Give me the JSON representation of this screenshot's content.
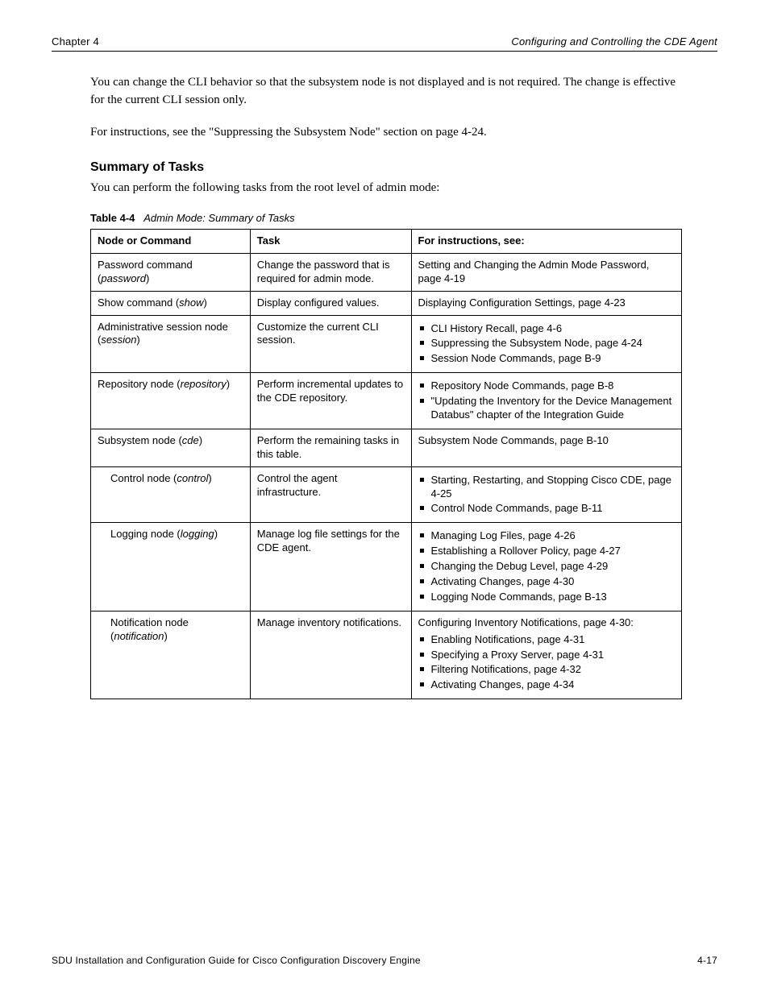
{
  "header": {
    "left": "Chapter 4",
    "right": "Configuring and Controlling the CDE Agent"
  },
  "para1": "You can change the CLI behavior so that the subsystem node is not displayed and is not required. The change is effective for the current CLI session only.",
  "para2_prefix": "For instructions, see the ",
  "para2_link": "\"Suppressing the Subsystem Node\" section on page 4-24",
  "para2_suffix": ".",
  "section_title": "Summary of Tasks",
  "section_subtitle": "You can perform the following tasks from the root level of admin mode:",
  "table_caption_label": "Table 4-4",
  "table_caption_text": "Admin Mode: Summary of Tasks",
  "table": {
    "headers": [
      "Node or Command",
      "Task",
      "For instructions, see:"
    ],
    "rows": [
      {
        "node": "Password command (password)",
        "nodeItalic": "password",
        "nodeItalicMode": "paren",
        "task": "Change the password that is required for admin mode.",
        "see": "Setting and Changing the Admin Mode Password, page 4-19"
      },
      {
        "node": "Show command (show)",
        "nodeItalic": "show",
        "nodeItalicMode": "paren",
        "task": "Display configured values.",
        "see": "Displaying Configuration Settings, page 4-23"
      },
      {
        "node": "Administrative session node (session)",
        "nodeItalic": "session",
        "nodeItalicMode": "paren",
        "task": "Customize the current CLI session.",
        "seeList": [
          "CLI History Recall, page 4-6",
          "Suppressing the Subsystem Node, page 4-24",
          "Session Node Commands, page B-9"
        ]
      },
      {
        "node": "Repository node (repository)",
        "nodeItalic": "repository",
        "nodeItalicMode": "paren",
        "task": "Perform incremental updates to the CDE repository.",
        "seeList": [
          "Repository Node Commands, page B-8",
          "\"Updating the Inventory for the Device Management Databus\" chapter of the Integration Guide"
        ]
      },
      {
        "node": "Subsystem node (cde)",
        "nodeItalic": "cde",
        "nodeItalicMode": "paren",
        "task": "Perform the remaining tasks in this table.",
        "see": "Subsystem Node Commands, page B-10"
      },
      {
        "node": "    Control node (control)",
        "nodeItalic": "control",
        "nodeItalicMode": "paren",
        "task": "Control the agent infrastructure.",
        "seeList": [
          "Starting, Restarting, and Stopping Cisco CDE, page 4-25",
          "Control Node Commands, page B-11"
        ]
      },
      {
        "node": "    Logging node (logging)",
        "nodeItalic": "logging",
        "nodeItalicMode": "paren",
        "task": "Manage log file settings for the CDE agent.",
        "seeList": [
          "Managing Log Files, page 4-26",
          "Establishing a Rollover Policy, page 4-27",
          "Changing the Debug Level, page 4-29",
          "Activating Changes, page 4-30",
          "Logging Node Commands, page B-13"
        ]
      },
      {
        "node": "    Notification node (notification)",
        "nodeItalic": "notification",
        "nodeItalicMode": "paren",
        "task": "Manage inventory notifications.",
        "seeLead": "Configuring Inventory Notifications, page 4-30:",
        "seeList": [
          "Enabling Notifications, page 4-31",
          "Specifying a Proxy Server, page 4-31",
          "Filtering Notifications, page 4-32",
          "Activating Changes, page 4-34"
        ]
      }
    ]
  },
  "footer": {
    "left": "SDU Installation and Configuration Guide for Cisco Configuration Discovery Engine",
    "right": "4-17"
  }
}
